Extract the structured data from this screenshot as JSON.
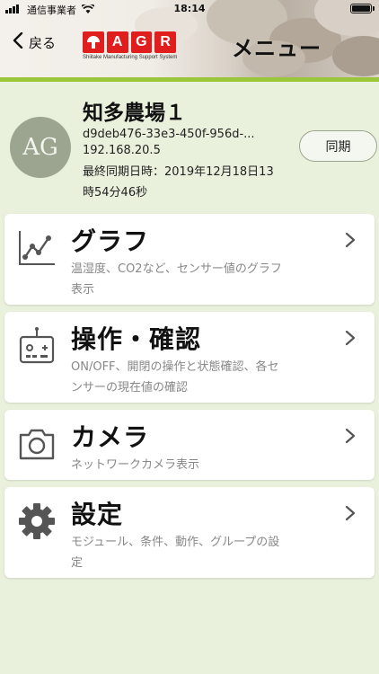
{
  "statusbar": {
    "carrier": "通信事業者",
    "time": "18:14"
  },
  "nav": {
    "back_label": "戻る",
    "title": "メニュー"
  },
  "logo": {
    "letters": [
      "A",
      "G",
      "R"
    ],
    "tagline": "Shiitake Manufacturing Support System"
  },
  "farm": {
    "avatar_text": "AG",
    "name": "知多農場１",
    "id": "d9deb476-33e3-450f-956d-...",
    "ip": "192.168.20.5",
    "last_sync_line1": "最終同期日時：2019年12月18日13",
    "last_sync_line2": "時54分46秒",
    "sync_label": "同期"
  },
  "menu": [
    {
      "title": "グラフ",
      "desc1": "温湿度、CO2など、センサー値のグラフ",
      "desc2": "表示",
      "icon": "line-chart-icon"
    },
    {
      "title": "操作・確認",
      "desc1": "ON/OFF、開閉の操作と状態確認、各セ",
      "desc2": "ンサーの現在値の確認",
      "icon": "remote-control-icon"
    },
    {
      "title": "カメラ",
      "desc1": "ネットワークカメラ表示",
      "desc2": "",
      "icon": "camera-icon"
    },
    {
      "title": "設定",
      "desc1": "モジュール、条件、動作、グループの設",
      "desc2": "定",
      "icon": "gear-icon"
    }
  ],
  "colors": {
    "background": "#e9f1dd",
    "accent_green": "#9bc63b",
    "logo_red": "#e01e1e",
    "avatar": "#9ca58f"
  }
}
